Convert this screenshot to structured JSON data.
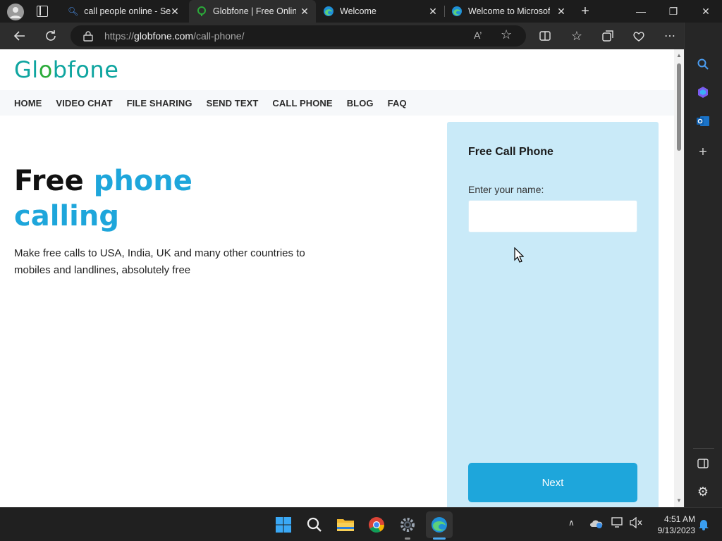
{
  "browser": {
    "tabs": [
      {
        "label": "call people online - Se",
        "active": false
      },
      {
        "label": "Globfone | Free Online",
        "active": true
      },
      {
        "label": "Welcome",
        "active": false
      },
      {
        "label": "Welcome to Microsoft",
        "active": false
      }
    ],
    "url_prefix": "https://",
    "url_domain": "globfone.com",
    "url_path": "/call-phone/"
  },
  "site": {
    "logo": {
      "part1": "Gl",
      "part2": "o",
      "part3": "bfone"
    },
    "menu": [
      "HOME",
      "VIDEO CHAT",
      "FILE SHARING",
      "SEND TEXT",
      "CALL PHONE",
      "BLOG",
      "FAQ"
    ],
    "hero": {
      "title_black": "Free",
      "title_blue_1": "phone",
      "title_blue_2": "calling",
      "description": "Make free calls to USA, India, UK and many other countries to mobiles and landlines, absolutely free"
    },
    "panel": {
      "title": "Free Call Phone",
      "name_label": "Enter your name:",
      "name_value": "",
      "next_label": "Next"
    }
  },
  "taskbar": {
    "time": "4:51 AM",
    "date": "9/13/2023"
  },
  "colors": {
    "accent": "#1ea6db",
    "panel_bg": "#c9eaf8",
    "logo_teal": "#0fa5a0",
    "logo_green": "#2bab3a"
  }
}
